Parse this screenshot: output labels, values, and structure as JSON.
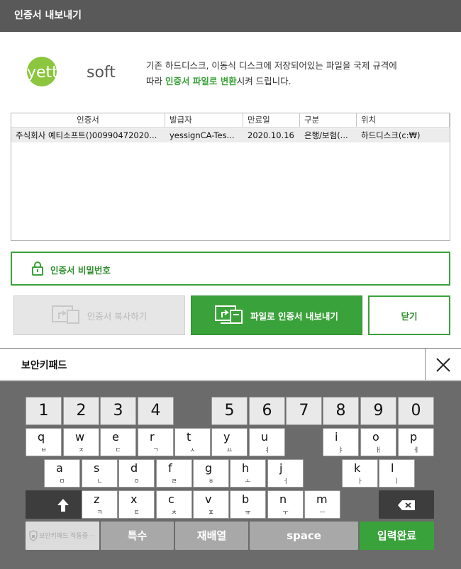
{
  "window": {
    "title": "인증서 내보내기"
  },
  "logo": {
    "text_a": "yettie",
    "text_b": "soft"
  },
  "description": {
    "line1": "기존 하드디스크, 이동식 디스크에 저장되어있는 파일을 국제 규격에",
    "line2_pre": "따라 ",
    "line2_highlight": "인증서 파일로 변환",
    "line2_post": "시켜 드립니다."
  },
  "cert_table": {
    "headers": [
      "인증서",
      "발급자",
      "만료일",
      "구분",
      "위치"
    ],
    "rows": [
      [
        "주식회사 예티소프트()00990472020...",
        "yessignCA-Tes...",
        "2020.10.16",
        "은행/보험(...",
        "하드디스크(c:₩)"
      ]
    ]
  },
  "password": {
    "label": "인증서 비밀번호"
  },
  "buttons": {
    "copy": "인증서 복사하기",
    "export": "파일로 인증서 내보내기",
    "close": "닫기"
  },
  "keypad": {
    "title": "보안키패드",
    "numbers": [
      "1",
      "2",
      "3",
      "4",
      "5",
      "6",
      "7",
      "8",
      "9",
      "0"
    ],
    "row1": [
      {
        "k": "q",
        "h": "ㅂ"
      },
      {
        "k": "w",
        "h": "ㅈ"
      },
      {
        "k": "e",
        "h": "ㄷ"
      },
      {
        "k": "r",
        "h": "ㄱ"
      },
      {
        "k": "t",
        "h": "ㅅ"
      },
      {
        "k": "y",
        "h": "ㅛ"
      },
      {
        "k": "u",
        "h": "ㅕ"
      },
      {
        "k": "i",
        "h": "ㅑ"
      },
      {
        "k": "o",
        "h": "ㅐ"
      },
      {
        "k": "p",
        "h": "ㅔ"
      }
    ],
    "row2": [
      {
        "k": "a",
        "h": "ㅁ"
      },
      {
        "k": "s",
        "h": "ㄴ"
      },
      {
        "k": "d",
        "h": "ㅇ"
      },
      {
        "k": "f",
        "h": "ㄹ"
      },
      {
        "k": "g",
        "h": "ㅎ"
      },
      {
        "k": "h",
        "h": "ㅗ"
      },
      {
        "k": "j",
        "h": "ㅓ"
      },
      {
        "k": "k",
        "h": "ㅏ"
      },
      {
        "k": "l",
        "h": "ㅣ"
      }
    ],
    "row3": [
      {
        "k": "z",
        "h": "ㅋ"
      },
      {
        "k": "x",
        "h": "ㅌ"
      },
      {
        "k": "c",
        "h": "ㅊ"
      },
      {
        "k": "v",
        "h": "ㅍ"
      },
      {
        "k": "b",
        "h": "ㅠ"
      },
      {
        "k": "n",
        "h": "ㅜ"
      },
      {
        "k": "m",
        "h": "ㅡ"
      }
    ],
    "status": "보안키패드 작동중···",
    "special": "특수",
    "shuffle": "재배열",
    "space": "space",
    "done": "입력완료"
  },
  "colors": {
    "accent": "#3aa23a",
    "titlebar": "#595959",
    "keyboard_bg": "#6b6b6b"
  }
}
